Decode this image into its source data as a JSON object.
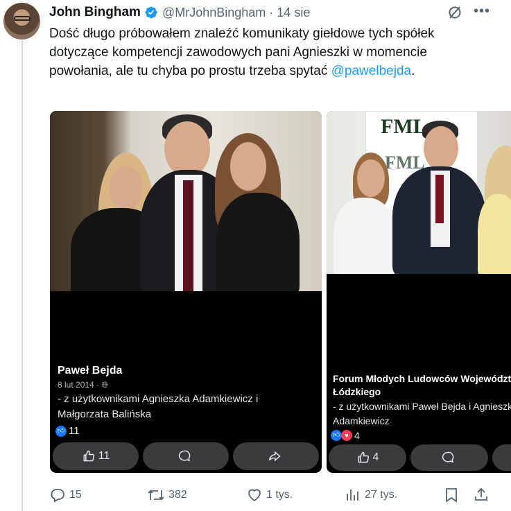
{
  "author": {
    "name": "John Bingham",
    "handle": "@MrJohnBingham",
    "date": "14 sie"
  },
  "tweet": {
    "text": "Dość długo próbowałem znaleźć komunikaty giełdowe tych spółek dotyczące kompetencji zawodowych pani Agnieszki w momencie powołania, ale tu chyba po prostu trzeba spytać ",
    "mention": "@pawelbejda",
    "trailing": "."
  },
  "images": [
    {
      "author": "Paweł Bejda",
      "date": "8 lut 2014 ·",
      "text": "- z użytkownikami Agnieszka Adamkiewicz i Małgorzata Balińska",
      "reaction_count": "11",
      "like_button_count": "11"
    },
    {
      "author": "Forum Młodych Ludowców Województwa Łódzkiego",
      "text": "- z użytkownikami Paweł Bejda i Agnieszka Adamkiewicz",
      "reaction_count": "4",
      "like_button_count": "4",
      "banner_text": "FML"
    }
  ],
  "actions": {
    "replies": "15",
    "reposts": "382",
    "likes": "1 tys.",
    "views": "27 tys."
  },
  "colors": {
    "accent": "#1d9bf0",
    "muted": "#536471"
  }
}
